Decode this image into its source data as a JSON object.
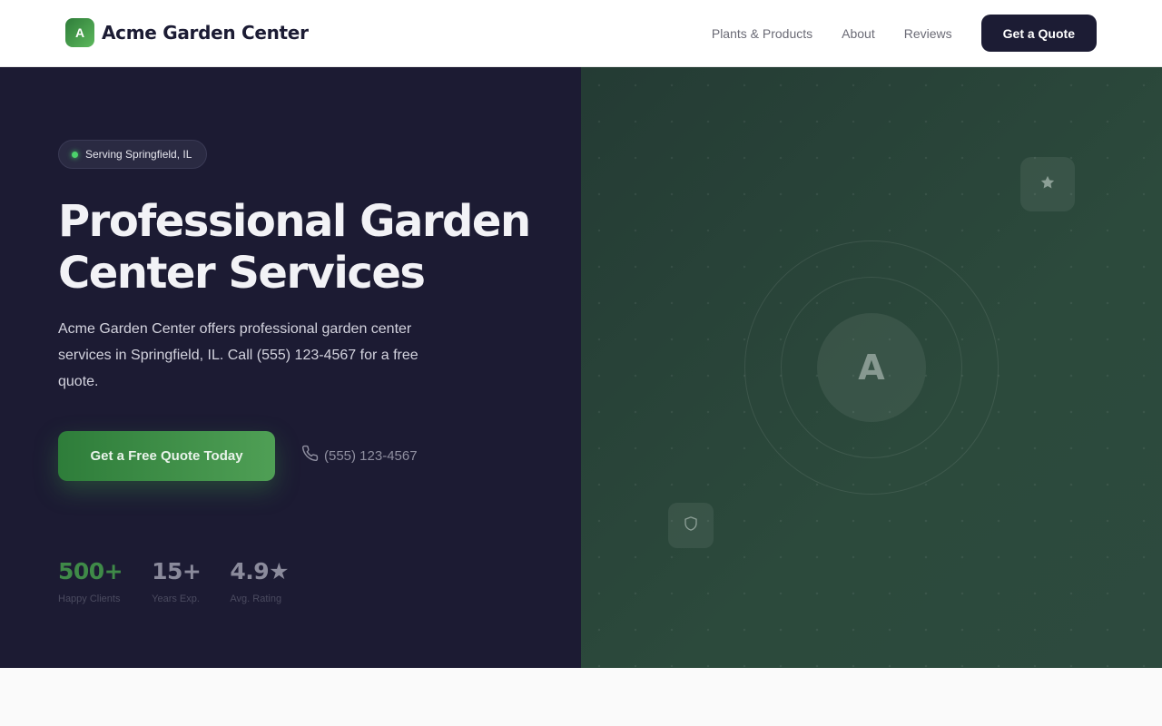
{
  "brand": {
    "logo_letter": "A",
    "name": "Acme Garden Center"
  },
  "nav": {
    "links": [
      {
        "label": "Plants & Products"
      },
      {
        "label": "About"
      },
      {
        "label": "Reviews"
      }
    ],
    "cta_label": "Get a Quote"
  },
  "hero": {
    "location_badge": "Serving Springfield, IL",
    "headline_line1": "Professional Garden",
    "headline_line2": "Center Services",
    "description": "Acme Garden Center offers professional garden center services in Springfield, IL. Call (555) 123-4567 for a free quote.",
    "primary_cta": "Get a Free Quote Today",
    "phone": "(555) 123-4567",
    "stats": [
      {
        "value": "500+",
        "label": "Happy Clients",
        "color": "#3f8a48"
      },
      {
        "value": "15+",
        "label": "Years Exp.",
        "color": "#8b8b9c"
      },
      {
        "value": "4.9★",
        "label": "Avg. Rating",
        "color": "#8b8b9c"
      }
    ],
    "visual_letter": "A"
  },
  "colors": {
    "accent_green": "#3d8b45",
    "dark_navy": "#1c1b33",
    "hero_right_green": "#29403a",
    "status_dot": "#4cd36b"
  },
  "icons": {
    "phone": "phone-icon",
    "star": "star-icon",
    "shield": "shield-icon"
  }
}
